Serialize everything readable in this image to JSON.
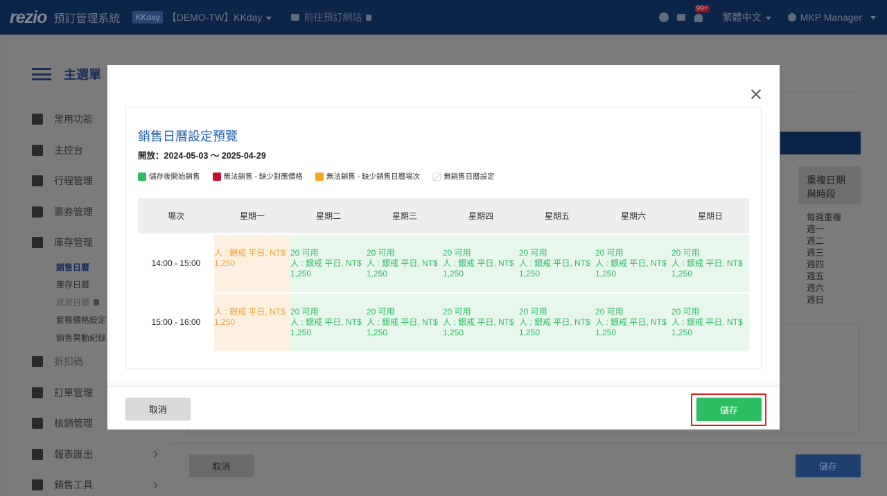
{
  "topbar": {
    "logo": "rezio",
    "system_name": "預訂管理系統",
    "tenant_badge": "KKday",
    "tenant_name": "【DEMO-TW】KKday",
    "goto_site": "前往預訂網站",
    "notification_count": "99+",
    "language": "繁體中文",
    "user": "MKP Manager"
  },
  "sidebar": {
    "title": "主選單",
    "items": [
      {
        "label": "常用功能",
        "icon": "star-icon"
      },
      {
        "label": "主控台",
        "icon": "dashboard-icon"
      },
      {
        "label": "行程管理",
        "icon": "folder-star-icon"
      },
      {
        "label": "票券管理",
        "icon": "ticket-icon"
      },
      {
        "label": "庫存管理",
        "icon": "calendar-icon"
      }
    ],
    "sub_items": [
      {
        "label": "銷售日曆"
      },
      {
        "label": "庫存日曆"
      },
      {
        "label": "資源日曆"
      },
      {
        "label": "套餐價格設定"
      },
      {
        "label": "銷售異動紀錄"
      }
    ],
    "items_after": [
      {
        "label": "折扣碼",
        "icon": "tag-icon"
      },
      {
        "label": "訂單管理",
        "icon": "document-icon"
      },
      {
        "label": "核銷管理",
        "icon": "scan-icon"
      },
      {
        "label": "報表匯出",
        "icon": "download-icon"
      },
      {
        "label": "銷售工具",
        "icon": "tools-icon"
      }
    ]
  },
  "background": {
    "column_header": "重複日期與時段",
    "repeat_title": "每週重複",
    "repeat_days": [
      "週一",
      "週二",
      "週三",
      "週四",
      "週五",
      "週六",
      "週日"
    ],
    "cancel": "取消",
    "save": "儲存"
  },
  "modal": {
    "title": "銷售日曆設定預覽",
    "open_range": "開放：2024-05-03 ～ 2025-04-29",
    "legend": [
      {
        "label": "儲存後開始銷售",
        "color": "#2cbd60"
      },
      {
        "label": "無法銷售 - 缺少對應價格",
        "color": "#c8102e"
      },
      {
        "label": "無法銷售 - 缺少銷售日曆場次",
        "color": "#f5a623"
      },
      {
        "label": "無銷售日曆設定",
        "color": "#ffffff"
      }
    ],
    "table": {
      "headers": [
        "場次",
        "星期一",
        "星期二",
        "星期三",
        "星期四",
        "星期五",
        "星期六",
        "星期日"
      ],
      "rows": [
        {
          "time": "14:00 - 15:00",
          "cells": [
            {
              "status": "unavailable",
              "availability": "",
              "price": "人 : 銀戒 平日, NT$ 1,250"
            },
            {
              "status": "ok",
              "availability": "20 可用",
              "price": "人 : 銀戒 平日, NT$ 1,250"
            },
            {
              "status": "ok",
              "availability": "20 可用",
              "price": "人 : 銀戒 平日, NT$ 1,250"
            },
            {
              "status": "ok",
              "availability": "20 可用",
              "price": "人 : 銀戒 平日, NT$ 1,250"
            },
            {
              "status": "ok",
              "availability": "20 可用",
              "price": "人 : 銀戒 平日, NT$ 1,250"
            },
            {
              "status": "ok",
              "availability": "20 可用",
              "price": "人 : 銀戒 平日, NT$ 1,250"
            },
            {
              "status": "ok",
              "availability": "20 可用",
              "price": "人 : 銀戒 平日, NT$ 1,250"
            }
          ]
        },
        {
          "time": "15:00 - 16:00",
          "cells": [
            {
              "status": "unavailable",
              "availability": "",
              "price": "人 : 銀戒 平日, NT$ 1,250"
            },
            {
              "status": "ok",
              "availability": "20 可用",
              "price": "人 : 銀戒 平日, NT$ 1,250"
            },
            {
              "status": "ok",
              "availability": "20 可用",
              "price": "人 : 銀戒 平日, NT$ 1,250"
            },
            {
              "status": "ok",
              "availability": "20 可用",
              "price": "人 : 銀戒 平日, NT$ 1,250"
            },
            {
              "status": "ok",
              "availability": "20 可用",
              "price": "人 : 銀戒 平日, NT$ 1,250"
            },
            {
              "status": "ok",
              "availability": "20 可用",
              "price": "人 : 銀戒 平日, NT$ 1,250"
            },
            {
              "status": "ok",
              "availability": "20 可用",
              "price": "人 : 銀戒 平日, NT$ 1,250"
            }
          ]
        }
      ]
    },
    "cancel_label": "取消",
    "save_label": "儲存"
  }
}
